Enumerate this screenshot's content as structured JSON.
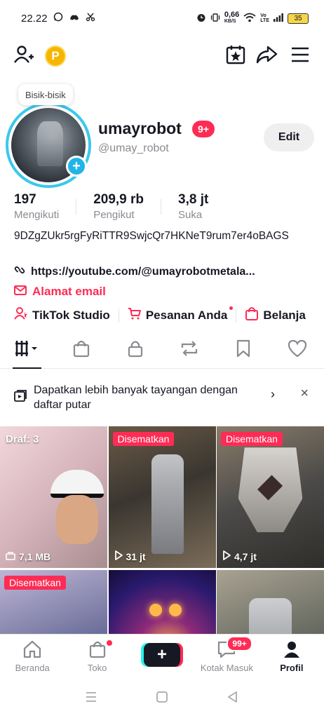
{
  "status_bar": {
    "time": "22.22",
    "net_speed": "0,66",
    "net_unit": "KB/S",
    "battery": "35"
  },
  "profile": {
    "bubble": "Bisik-bisik",
    "username": "umayrobot",
    "name_badge": "9+",
    "handle": "@umay_robot",
    "edit_label": "Edit",
    "stats": [
      {
        "value": "197",
        "label": "Mengikuti"
      },
      {
        "value": "209,9 rb",
        "label": "Pengikut"
      },
      {
        "value": "3,8 jt",
        "label": "Suka"
      }
    ],
    "bio": "9DZgZUkr5rgFyRiTTR9SwjcQr7HKNeT9rum7er4oBAGS",
    "link": "https://youtube.com/@umayrobotmetala...",
    "email_label": "Alamat email",
    "shortcuts": [
      "TikTok Studio",
      "Pesanan Anda",
      "Belanja"
    ]
  },
  "banner": {
    "text": "Dapatkan lebih banyak tayangan dengan daftar putar"
  },
  "grid": [
    {
      "overlay": "Draf: 3",
      "meta": "7,1 MB"
    },
    {
      "overlay": "Disematkan",
      "meta": "31 jt"
    },
    {
      "overlay": "Disematkan",
      "meta": "4,7 jt"
    },
    {
      "overlay": "Disematkan",
      "meta": ""
    },
    {
      "overlay": "",
      "meta": ""
    },
    {
      "overlay": "",
      "meta": ""
    }
  ],
  "bottom_nav": {
    "items": [
      {
        "label": "Beranda"
      },
      {
        "label": "Toko"
      },
      {
        "label": ""
      },
      {
        "label": "Kotak Masuk",
        "badge": "99+"
      },
      {
        "label": "Profil"
      }
    ]
  },
  "colors": {
    "accent": "#fe2c55",
    "ring": "#3ac8ec",
    "coin": "#f7b500"
  }
}
